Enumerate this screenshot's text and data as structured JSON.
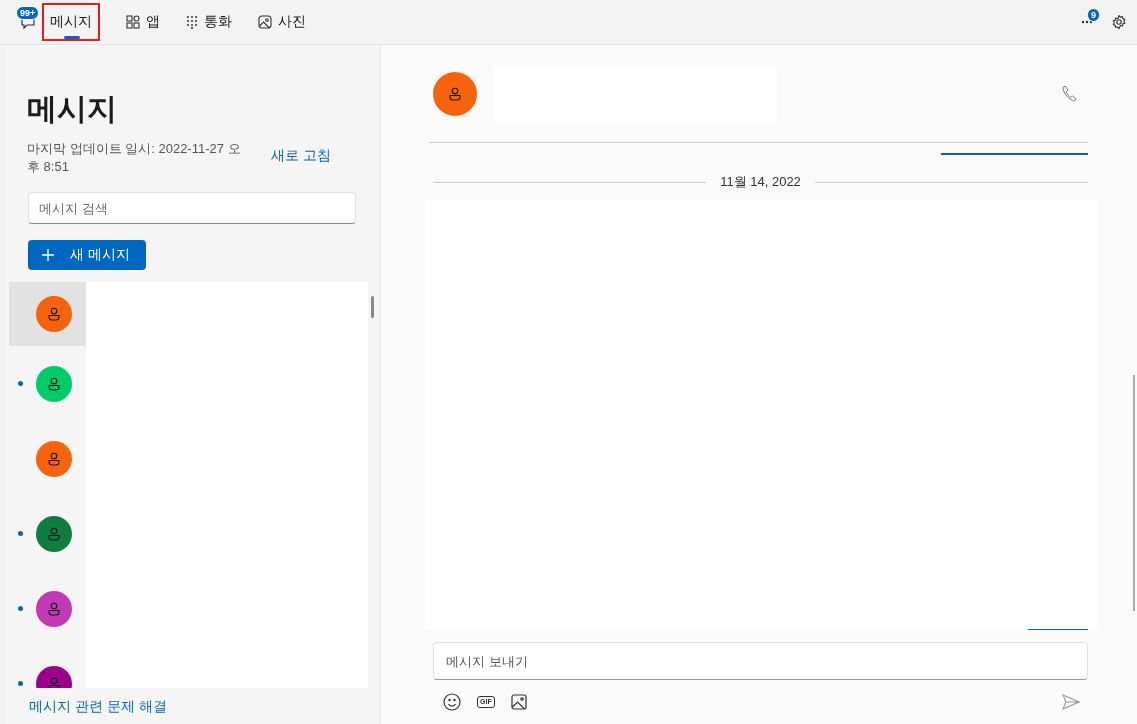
{
  "top_bar": {
    "tabs": [
      {
        "kind": "chat",
        "label": "메시지",
        "badge": "99+",
        "selected": true,
        "highlighted": true
      },
      {
        "kind": "apps",
        "label": "앱",
        "selected": false,
        "highlighted": false
      },
      {
        "kind": "dialpad",
        "label": "통화",
        "selected": false,
        "highlighted": false
      },
      {
        "kind": "photos",
        "label": "사진",
        "selected": false,
        "highlighted": false
      }
    ],
    "more_badge": "9"
  },
  "sidebar": {
    "title": "메시지",
    "updated": "마지막 업데이트 일시: 2022-11-27 오후 8:51",
    "refresh": "새로 고침",
    "search": {
      "placeholder": "메시지 검색"
    },
    "new_message": "새 메시지",
    "conversations": [
      {
        "color": "#f7630c",
        "unread": false,
        "selected": true
      },
      {
        "color": "#00cc6a",
        "unread": true,
        "selected": false
      },
      {
        "color": "#f7630c",
        "unread": false,
        "selected": false
      },
      {
        "color": "#107c41",
        "unread": true,
        "selected": false
      },
      {
        "color": "#c239b3",
        "unread": true,
        "selected": false
      },
      {
        "color": "#9a0089",
        "unread": true,
        "selected": false
      }
    ],
    "troubleshoot": "메시지 관련 문제 해결"
  },
  "chat": {
    "date": "11월 14, 2022",
    "compose": {
      "placeholder": "메시지 보내기"
    },
    "gif_label": "GIF"
  }
}
